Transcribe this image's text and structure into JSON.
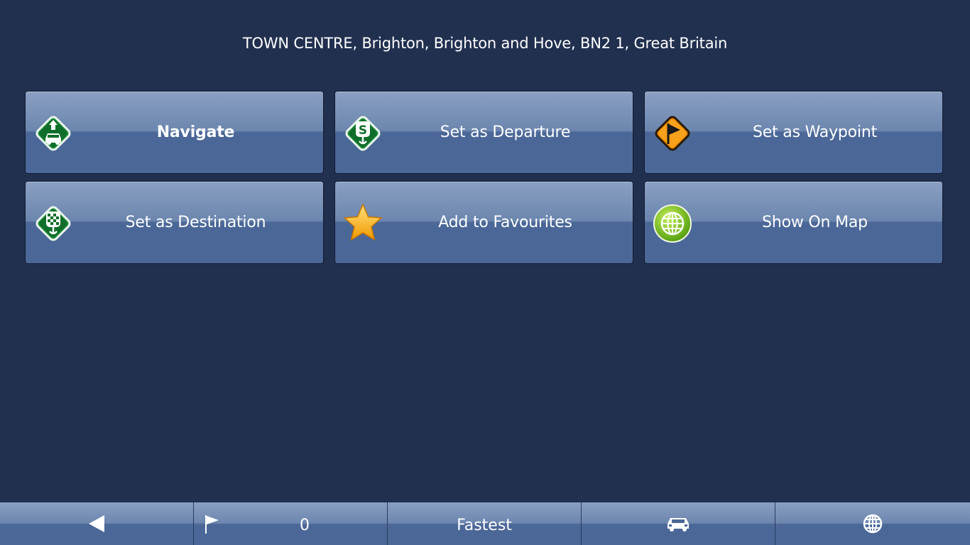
{
  "header": {
    "address": "TOWN CENTRE, Brighton, Brighton and Hove, BN2 1, Great Britain"
  },
  "actions": [
    {
      "label": "Navigate",
      "icon": "navigate-car-icon"
    },
    {
      "label": "Set as Departure",
      "icon": "departure-pin-icon"
    },
    {
      "label": "Set as Waypoint",
      "icon": "waypoint-flag-icon"
    },
    {
      "label": "Set as Destination",
      "icon": "destination-checkered-icon"
    },
    {
      "label": "Add to Favourites",
      "icon": "star-icon"
    },
    {
      "label": "Show On Map",
      "icon": "globe-icon"
    }
  ],
  "bottom_bar": {
    "back_icon": "back-arrow-icon",
    "waypoint_count": "0",
    "waypoint_icon": "flag-icon",
    "route_mode": "Fastest",
    "vehicle_icon": "car-icon",
    "map_icon": "globe-icon"
  },
  "colors": {
    "background": "#21304f",
    "button_top": "#8aa0c3",
    "button_bottom": "#4a6797",
    "icon_green": "#1f8a3a",
    "icon_orange": "#f08a00",
    "star_yellow": "#f7b21a",
    "globe_green": "#7cc10f"
  }
}
